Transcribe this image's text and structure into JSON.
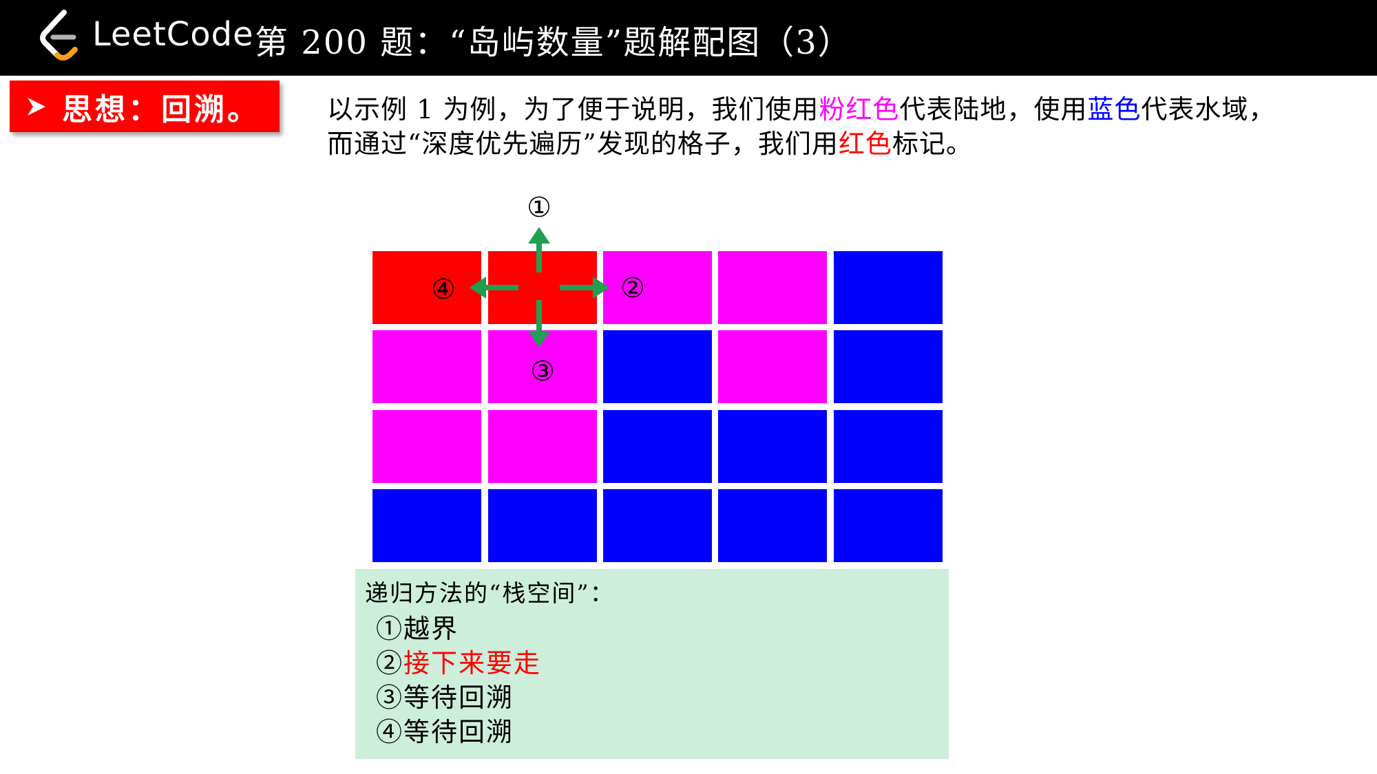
{
  "header": {
    "brand": "LeetCode",
    "title": "第 200 题：“岛屿数量”题解配图（3）"
  },
  "idea": {
    "label": "思想：回溯。"
  },
  "description": {
    "line1": {
      "a": "以示例 1 为例，为了便于说明，我们使用",
      "pink": "粉红色",
      "b": "代表陆地，使用",
      "blue": "蓝色",
      "c": "代表水域，"
    },
    "line2": {
      "a": "而通过“深度优先遍历”发现的格子，我们用",
      "red": "红色",
      "b": "标记。"
    }
  },
  "grid": {
    "rows": 4,
    "cols": 5,
    "colors": {
      "red": "#ff0000",
      "pink": "#ff00ff",
      "blue": "#0000ff",
      "arrow": "#1fa050"
    },
    "cells": [
      [
        "red",
        "red",
        "pink",
        "pink",
        "blue"
      ],
      [
        "pink",
        "pink",
        "blue",
        "pink",
        "blue"
      ],
      [
        "pink",
        "pink",
        "blue",
        "blue",
        "blue"
      ],
      [
        "blue",
        "blue",
        "blue",
        "blue",
        "blue"
      ]
    ],
    "directions": {
      "up": "①",
      "right": "②",
      "down": "③",
      "left": "④"
    }
  },
  "stack": {
    "title": "递归方法的“栈空间”：",
    "items": [
      {
        "marker": "①",
        "text": "越界",
        "highlight": false
      },
      {
        "marker": "②",
        "text": "接下来要走",
        "highlight": true
      },
      {
        "marker": "③",
        "text": "等待回溯",
        "highlight": false
      },
      {
        "marker": "④",
        "text": "等待回溯",
        "highlight": false
      }
    ]
  }
}
